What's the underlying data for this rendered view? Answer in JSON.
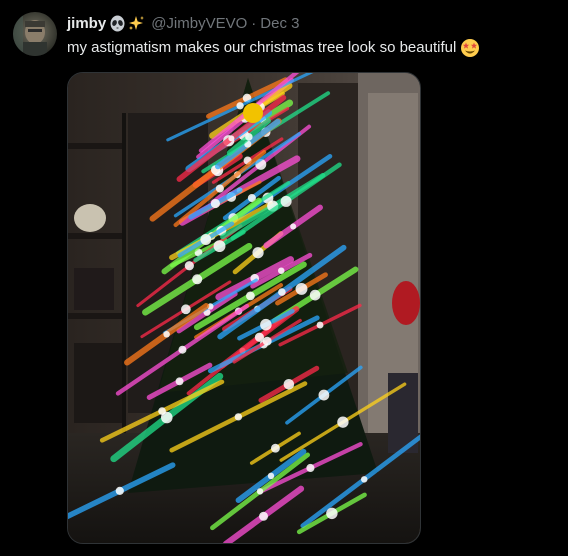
{
  "tweet": {
    "author_name": "jimby",
    "author_handle": "@JimbyVEVO",
    "separator": "·",
    "date": "Dec 3",
    "text": "my astigmatism makes our christmas tree look so beautiful",
    "emoji": [
      "alien-emoji",
      "sparkles-emoji",
      "star-struck-emoji"
    ]
  },
  "media": {
    "kind": "photo",
    "subject": "christmas-tree-with-starburst-lights"
  },
  "colors": {
    "background": "#000000",
    "primary_text": "#e7e9ea",
    "secondary_text": "#71767b",
    "border": "#2f3336"
  }
}
